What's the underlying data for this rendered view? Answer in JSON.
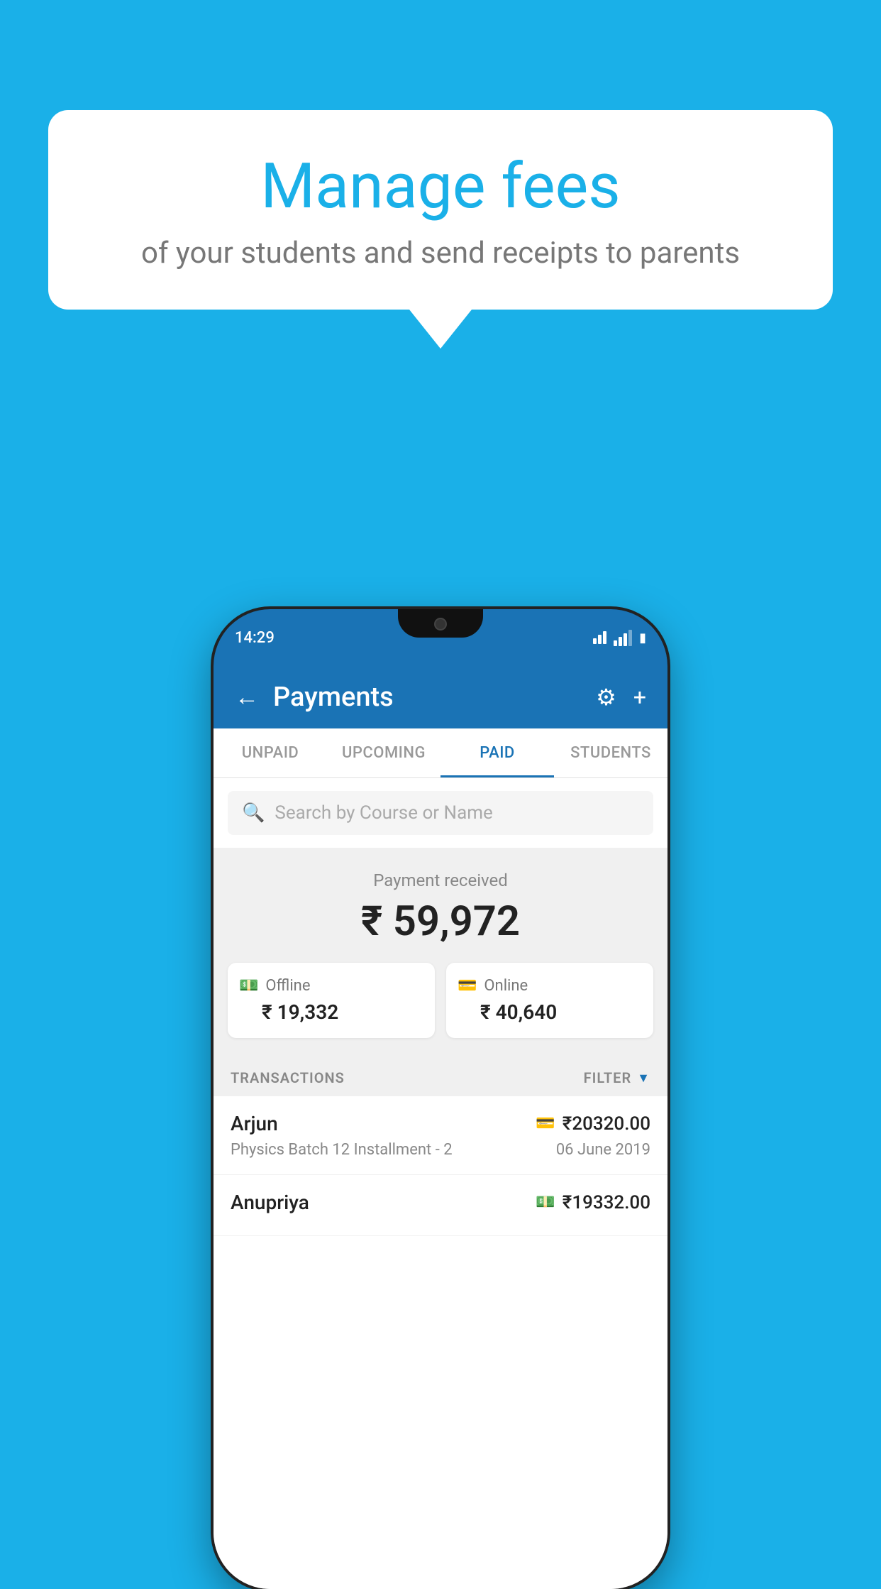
{
  "background_color": "#1ab0e8",
  "speech_bubble": {
    "title": "Manage fees",
    "subtitle": "of your students and send receipts to parents"
  },
  "status_bar": {
    "time": "14:29"
  },
  "header": {
    "title": "Payments",
    "back_label": "←",
    "settings_label": "⚙",
    "add_label": "+"
  },
  "tabs": [
    {
      "id": "unpaid",
      "label": "UNPAID",
      "active": false
    },
    {
      "id": "upcoming",
      "label": "UPCOMING",
      "active": false
    },
    {
      "id": "paid",
      "label": "PAID",
      "active": true
    },
    {
      "id": "students",
      "label": "STUDENTS",
      "active": false
    }
  ],
  "search": {
    "placeholder": "Search by Course or Name"
  },
  "payment_summary": {
    "label": "Payment received",
    "total": "₹ 59,972",
    "offline_label": "Offline",
    "offline_amount": "₹ 19,332",
    "online_label": "Online",
    "online_amount": "₹ 40,640"
  },
  "transactions": {
    "section_label": "TRANSACTIONS",
    "filter_label": "FILTER",
    "items": [
      {
        "name": "Arjun",
        "description": "Physics Batch 12 Installment - 2",
        "amount": "₹20320.00",
        "date": "06 June 2019",
        "payment_type": "card"
      },
      {
        "name": "Anupriya",
        "description": "",
        "amount": "₹19332.00",
        "date": "",
        "payment_type": "cash"
      }
    ]
  }
}
